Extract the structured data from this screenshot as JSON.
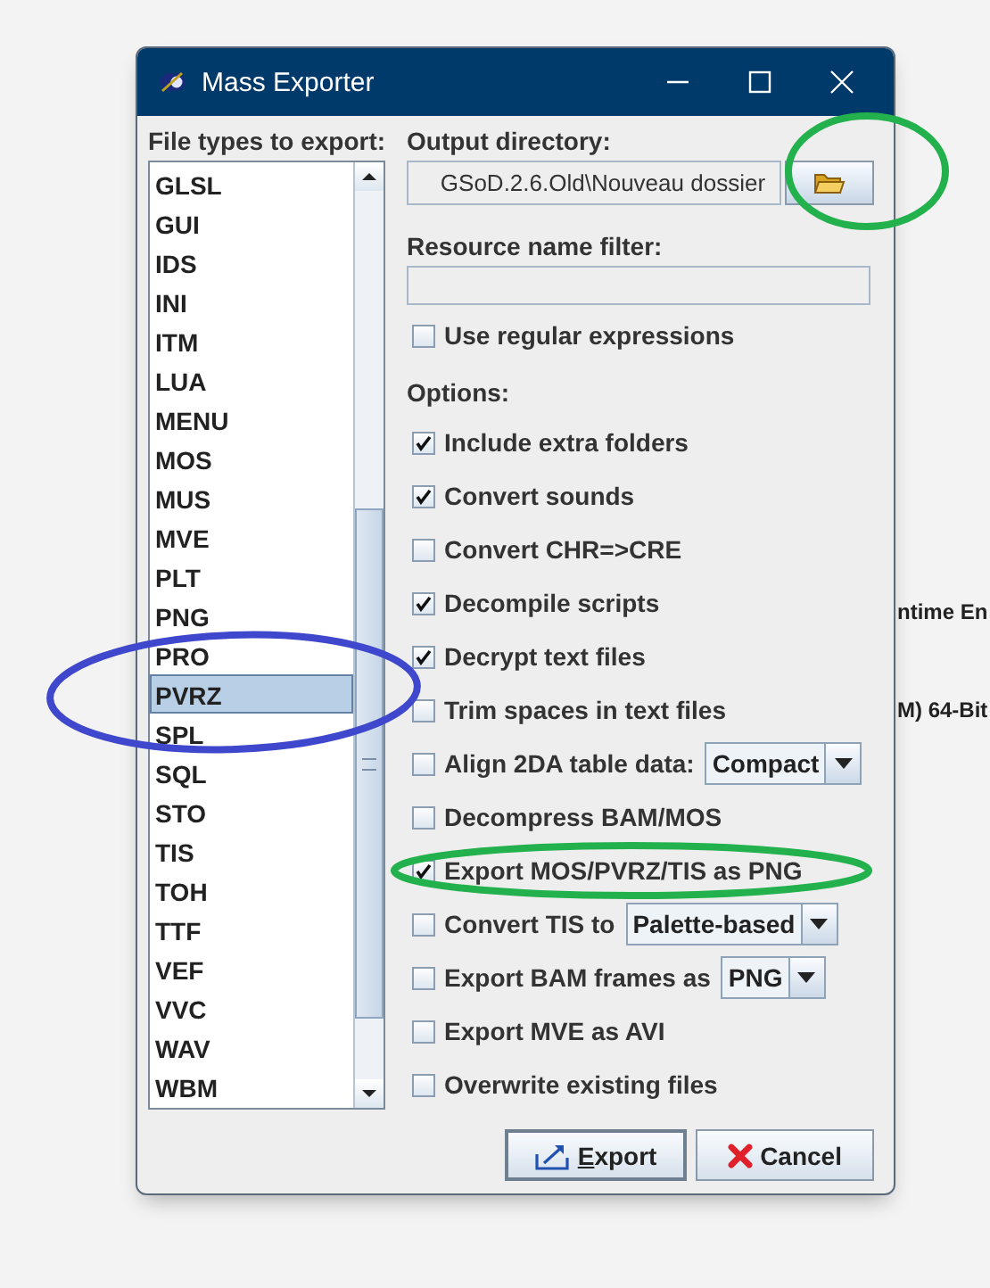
{
  "window": {
    "title": "Mass Exporter"
  },
  "file_types": {
    "label": "File types to export:",
    "items": [
      {
        "label": "GLSL",
        "selected": false
      },
      {
        "label": "GUI",
        "selected": false
      },
      {
        "label": "IDS",
        "selected": false
      },
      {
        "label": "INI",
        "selected": false
      },
      {
        "label": "ITM",
        "selected": false
      },
      {
        "label": "LUA",
        "selected": false
      },
      {
        "label": "MENU",
        "selected": false
      },
      {
        "label": "MOS",
        "selected": false
      },
      {
        "label": "MUS",
        "selected": false
      },
      {
        "label": "MVE",
        "selected": false
      },
      {
        "label": "PLT",
        "selected": false
      },
      {
        "label": "PNG",
        "selected": false
      },
      {
        "label": "PRO",
        "selected": false
      },
      {
        "label": "PVRZ",
        "selected": true
      },
      {
        "label": "SPL",
        "selected": false
      },
      {
        "label": "SQL",
        "selected": false
      },
      {
        "label": "STO",
        "selected": false
      },
      {
        "label": "TIS",
        "selected": false
      },
      {
        "label": "TOH",
        "selected": false
      },
      {
        "label": "TTF",
        "selected": false
      },
      {
        "label": "VEF",
        "selected": false
      },
      {
        "label": "VVC",
        "selected": false
      },
      {
        "label": "WAV",
        "selected": false
      },
      {
        "label": "WBM",
        "selected": false
      }
    ]
  },
  "output_directory": {
    "label": "Output directory:",
    "value": "GSoD.2.6.Old\\Nouveau dossier"
  },
  "resource_filter": {
    "label": "Resource name filter:",
    "regex": {
      "label": "Use regular expressions",
      "checked": false
    }
  },
  "options_label": "Options:",
  "options": [
    {
      "kind": "check",
      "label": "Include extra folders",
      "checked": true
    },
    {
      "kind": "check",
      "label": "Convert sounds",
      "checked": true
    },
    {
      "kind": "check",
      "label": "Convert CHR=>CRE",
      "checked": false
    },
    {
      "kind": "check",
      "label": "Decompile scripts",
      "checked": true
    },
    {
      "kind": "check",
      "label": "Decrypt text files",
      "checked": true
    },
    {
      "kind": "check",
      "label": "Trim spaces in text files",
      "checked": false
    },
    {
      "kind": "combo",
      "label": "Align 2DA table data:",
      "checked": false,
      "value": "Compact"
    },
    {
      "kind": "check",
      "label": "Decompress BAM/MOS",
      "checked": false
    },
    {
      "kind": "check",
      "label": "Export MOS/PVRZ/TIS as PNG",
      "checked": true
    },
    {
      "kind": "combo",
      "label": "Convert TIS to",
      "checked": false,
      "value": "Palette-based"
    },
    {
      "kind": "combo",
      "label": "Export BAM frames as",
      "checked": false,
      "value": "PNG"
    },
    {
      "kind": "check",
      "label": "Export MVE as AVI",
      "checked": false
    },
    {
      "kind": "check",
      "label": "Overwrite existing files",
      "checked": false
    }
  ],
  "buttons": [
    {
      "kind": "export",
      "label": "Export",
      "mnemonic": true
    },
    {
      "kind": "cancel",
      "label": "Cancel",
      "mnemonic": false
    }
  ],
  "background_texts": [
    "ntime En",
    "M) 64-Bit"
  ],
  "annotations": [
    {
      "color": "#22b14c"
    },
    {
      "color": "#3f48cc"
    },
    {
      "color": "#22b14c"
    }
  ]
}
